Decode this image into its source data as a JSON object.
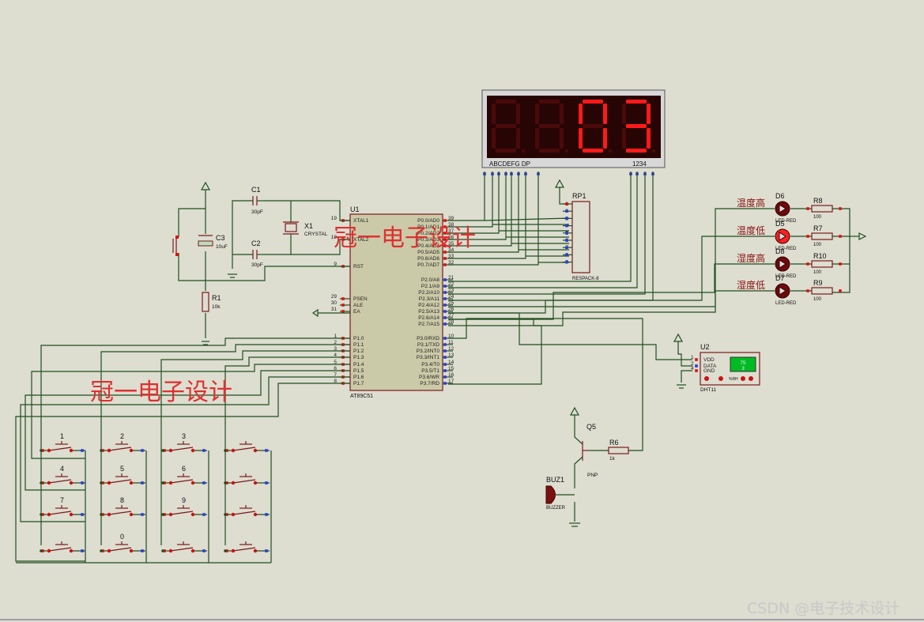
{
  "watermark": {
    "text": "冠一电子设计"
  },
  "footer": {
    "text": "CSDN @电子技术设计"
  },
  "display": {
    "digits": [
      "",
      "",
      "0",
      "3"
    ],
    "segment_label": "ABCDEFG  DP",
    "digit_label": "1234"
  },
  "mcu": {
    "ref": "U1",
    "part": "AT89C51",
    "left_pins": [
      {
        "num": "19",
        "name": "XTAL1"
      },
      {
        "num": "18",
        "name": "XTAL2"
      },
      {
        "num": "9",
        "name": "RST"
      },
      {
        "num": "29",
        "name": "PSEN"
      },
      {
        "num": "30",
        "name": "ALE"
      },
      {
        "num": "31",
        "name": "EA"
      },
      {
        "num": "1",
        "name": "P1.0"
      },
      {
        "num": "2",
        "name": "P1.1"
      },
      {
        "num": "3",
        "name": "P1.2"
      },
      {
        "num": "4",
        "name": "P1.3"
      },
      {
        "num": "5",
        "name": "P1.4"
      },
      {
        "num": "6",
        "name": "P1.5"
      },
      {
        "num": "7",
        "name": "P1.6"
      },
      {
        "num": "8",
        "name": "P1.7"
      }
    ],
    "right_pins": [
      {
        "num": "39",
        "name": "P0.0/AD0"
      },
      {
        "num": "38",
        "name": "P0.1/AD1"
      },
      {
        "num": "37",
        "name": "P0.2/AD2"
      },
      {
        "num": "36",
        "name": "P0.3/AD3"
      },
      {
        "num": "35",
        "name": "P0.4/AD4"
      },
      {
        "num": "34",
        "name": "P0.5/AD5"
      },
      {
        "num": "33",
        "name": "P0.6/AD6"
      },
      {
        "num": "32",
        "name": "P0.7/AD7"
      },
      {
        "num": "21",
        "name": "P2.0/A8"
      },
      {
        "num": "22",
        "name": "P2.1/A9"
      },
      {
        "num": "23",
        "name": "P2.2/A10"
      },
      {
        "num": "24",
        "name": "P2.3/A11"
      },
      {
        "num": "25",
        "name": "P2.4/A12"
      },
      {
        "num": "26",
        "name": "P2.5/A13"
      },
      {
        "num": "27",
        "name": "P2.6/A14"
      },
      {
        "num": "28",
        "name": "P2.7/A15"
      },
      {
        "num": "10",
        "name": "P3.0/RXD"
      },
      {
        "num": "11",
        "name": "P3.1/TXD"
      },
      {
        "num": "12",
        "name": "P3.2/INT0"
      },
      {
        "num": "13",
        "name": "P3.3/INT1"
      },
      {
        "num": "14",
        "name": "P3.4/T0"
      },
      {
        "num": "15",
        "name": "P3.5/T1"
      },
      {
        "num": "16",
        "name": "P3.6/WR"
      },
      {
        "num": "17",
        "name": "P3.7/RD"
      }
    ]
  },
  "crystal": {
    "ref": "X1",
    "label": "CRYSTAL"
  },
  "c1": {
    "ref": "C1",
    "value": "30pF"
  },
  "c2": {
    "ref": "C2",
    "value": "30pF"
  },
  "c3": {
    "ref": "C3",
    "value": "10uF"
  },
  "r1": {
    "ref": "R1",
    "value": "10k"
  },
  "rp1": {
    "ref": "RP1",
    "part": "RESPACK-8",
    "pins": [
      "1",
      "2",
      "3",
      "4",
      "5",
      "6",
      "7",
      "8",
      "9"
    ]
  },
  "leds": [
    {
      "ref": "D6",
      "text": "温度高",
      "part": "LED-RED",
      "rref": "R8",
      "rval": "100"
    },
    {
      "ref": "D5",
      "text": "温度低",
      "part": "LED-RED",
      "rref": "R7",
      "rval": "100"
    },
    {
      "ref": "D8",
      "text": "湿度高",
      "part": "LED-RED",
      "rref": "R10",
      "rval": "100"
    },
    {
      "ref": "D7",
      "text": "湿度低",
      "part": "LED-RED",
      "rref": "R9",
      "rval": "100"
    }
  ],
  "dht": {
    "ref": "U2",
    "part": "DHT11",
    "pins": [
      "VDD",
      "DATA",
      "GND"
    ],
    "pin_nums": [
      "1",
      "2",
      "4"
    ],
    "screen_top": "75",
    "screen_bottom": "3",
    "rh": "%RH"
  },
  "q5": {
    "ref": "Q5",
    "part": "PNP"
  },
  "r6": {
    "ref": "R6",
    "value": "1k"
  },
  "buzzer": {
    "ref": "BUZ1",
    "part": "BUZZER"
  },
  "keys": [
    "1",
    "2",
    "3",
    "",
    "4",
    "5",
    "6",
    "",
    "7",
    "8",
    "9",
    "",
    "",
    "0",
    "",
    ""
  ]
}
